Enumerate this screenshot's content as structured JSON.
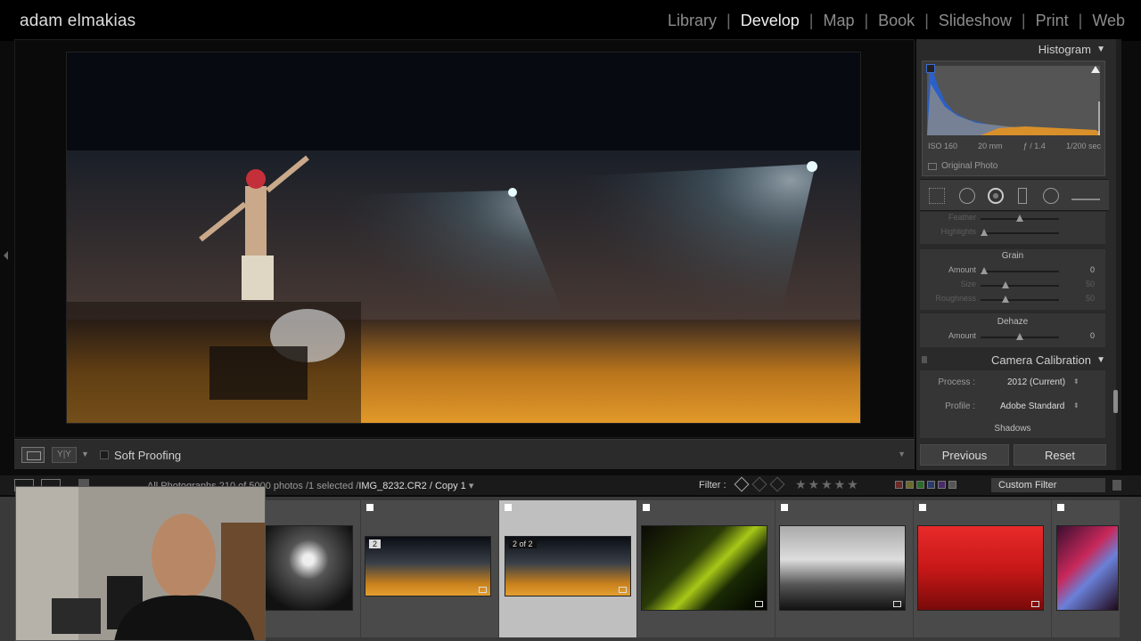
{
  "identity_plate": "adam elmakias",
  "modules": [
    "Library",
    "Develop",
    "Map",
    "Book",
    "Slideshow",
    "Print",
    "Web"
  ],
  "active_module": "Develop",
  "toolbar": {
    "soft_proofing_label": "Soft Proofing",
    "view_yy": "Y|Y"
  },
  "right_panel": {
    "histogram": {
      "title": "Histogram",
      "iso": "ISO 160",
      "focal": "20 mm",
      "aperture": "ƒ / 1.4",
      "shutter": "1/200 sec",
      "original_photo_label": "Original Photo"
    },
    "effects": {
      "feather_label": "Feather",
      "highlights_label": "Highlights",
      "grain_title": "Grain",
      "amount_label": "Amount",
      "amount_value": "0",
      "size_label": "Size",
      "size_value": "50",
      "roughness_label": "Roughness",
      "roughness_value": "50",
      "dehaze_title": "Dehaze",
      "dehaze_amount_label": "Amount",
      "dehaze_amount_value": "0"
    },
    "camera_calibration": {
      "title": "Camera Calibration",
      "process_label": "Process :",
      "process_value": "2012 (Current)",
      "profile_label": "Profile :",
      "profile_value": "Adobe Standard",
      "shadows_label": "Shadows"
    },
    "previous_label": "Previous",
    "reset_label": "Reset"
  },
  "filmstrip_bar": {
    "source_prefix": "All Photographs",
    "count": "210 of 5000 photos",
    "selected": "/1 selected /",
    "filename": "IMG_8232.CR2",
    "copy": "/ Copy 1",
    "filter_label": "Filter :",
    "custom_filter": "Custom Filter",
    "stars": "★★★★★"
  },
  "filmstrip": {
    "cells": [
      {
        "number": "",
        "selected": false
      },
      {
        "number": "2",
        "selected": false
      },
      {
        "number": "2 of 2",
        "selected": true
      },
      {
        "number": "",
        "selected": false
      },
      {
        "number": "",
        "selected": false
      },
      {
        "number": "",
        "selected": false
      },
      {
        "number": "",
        "selected": false
      }
    ]
  },
  "colors": {
    "accent": "#f0f0f0",
    "panel": "#2a2a2a",
    "filmstrip_selected": "#bfbfbf"
  }
}
